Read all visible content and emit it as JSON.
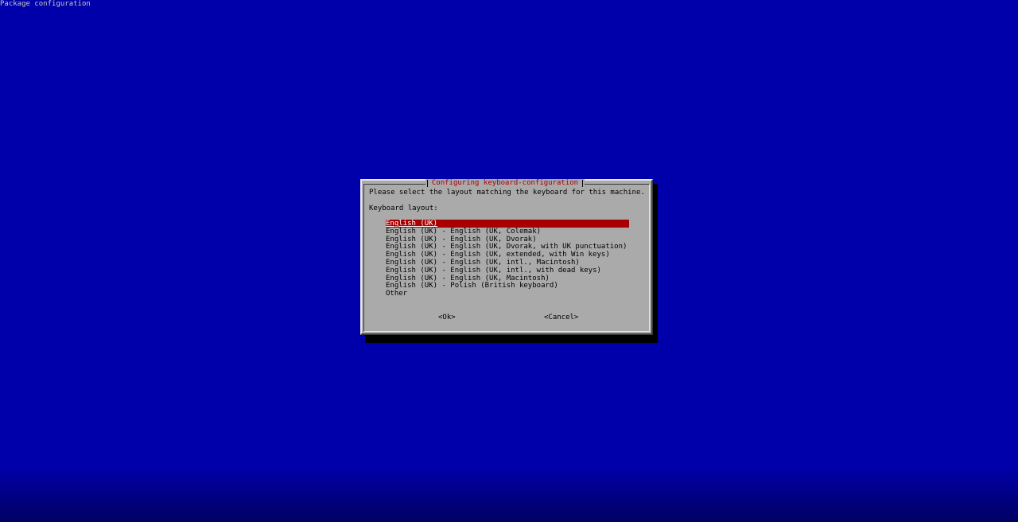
{
  "backtitle": "Package configuration",
  "dialog": {
    "title": "Configuring keyboard-configuration",
    "prompt": "Please select the layout matching the keyboard for this machine.",
    "field_label": "Keyboard layout:",
    "options": [
      "English (UK)",
      "English (UK) - English (UK, Colemak)",
      "English (UK) - English (UK, Dvorak)",
      "English (UK) - English (UK, Dvorak, with UK punctuation)",
      "English (UK) - English (UK, extended, with Win keys)",
      "English (UK) - English (UK, intl., Macintosh)",
      "English (UK) - English (UK, intl., with dead keys)",
      "English (UK) - English (UK, Macintosh)",
      "English (UK) - Polish (British keyboard)",
      "Other"
    ],
    "selected_index": 0,
    "ok_label": "<Ok>",
    "cancel_label": "<Cancel>"
  },
  "colors": {
    "background": "#0000aa",
    "dialog": "#aaaaaa",
    "title": "#a80000",
    "selection": "#a80000"
  }
}
